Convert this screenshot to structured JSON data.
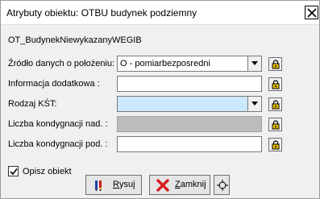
{
  "window": {
    "title": "Atrybuty obiektu: OTBU budynek podziemny"
  },
  "object_name": "OT_BudynekNiewykazanyWEGIB",
  "fields": [
    {
      "label": "Źródło danych o położeniu:",
      "value": "O - pomiarbezposredni",
      "type": "combo",
      "state": "normal"
    },
    {
      "label": "Informacja dodatkowa :",
      "value": "",
      "type": "text",
      "state": "normal"
    },
    {
      "label": "Rodzaj KŚT:",
      "value": "",
      "type": "combo",
      "state": "highlighted"
    },
    {
      "label": "Liczba kondygnacji nad. :",
      "value": "",
      "type": "text",
      "state": "disabled"
    },
    {
      "label": "Liczba kondygnacji pod. :",
      "value": "",
      "type": "text",
      "state": "normal"
    }
  ],
  "checkbox": {
    "label": "Opisz obiekt",
    "checked": true
  },
  "buttons": {
    "draw_prefix": "",
    "draw_mnemonic": "R",
    "draw_rest": "ysuj",
    "close_mnemonic": "Z",
    "close_rest": "amknij"
  },
  "icons": {
    "close": "close-icon",
    "dropdown": "chevron-down-icon",
    "lock": "lock-icon",
    "draw": "pencil-icon",
    "zamknij": "red-x-icon",
    "target": "crosshair-icon"
  },
  "colors": {
    "highlight": "#cce8ff",
    "disabled": "#bcbcbc",
    "red_x": "#d81e1e"
  }
}
